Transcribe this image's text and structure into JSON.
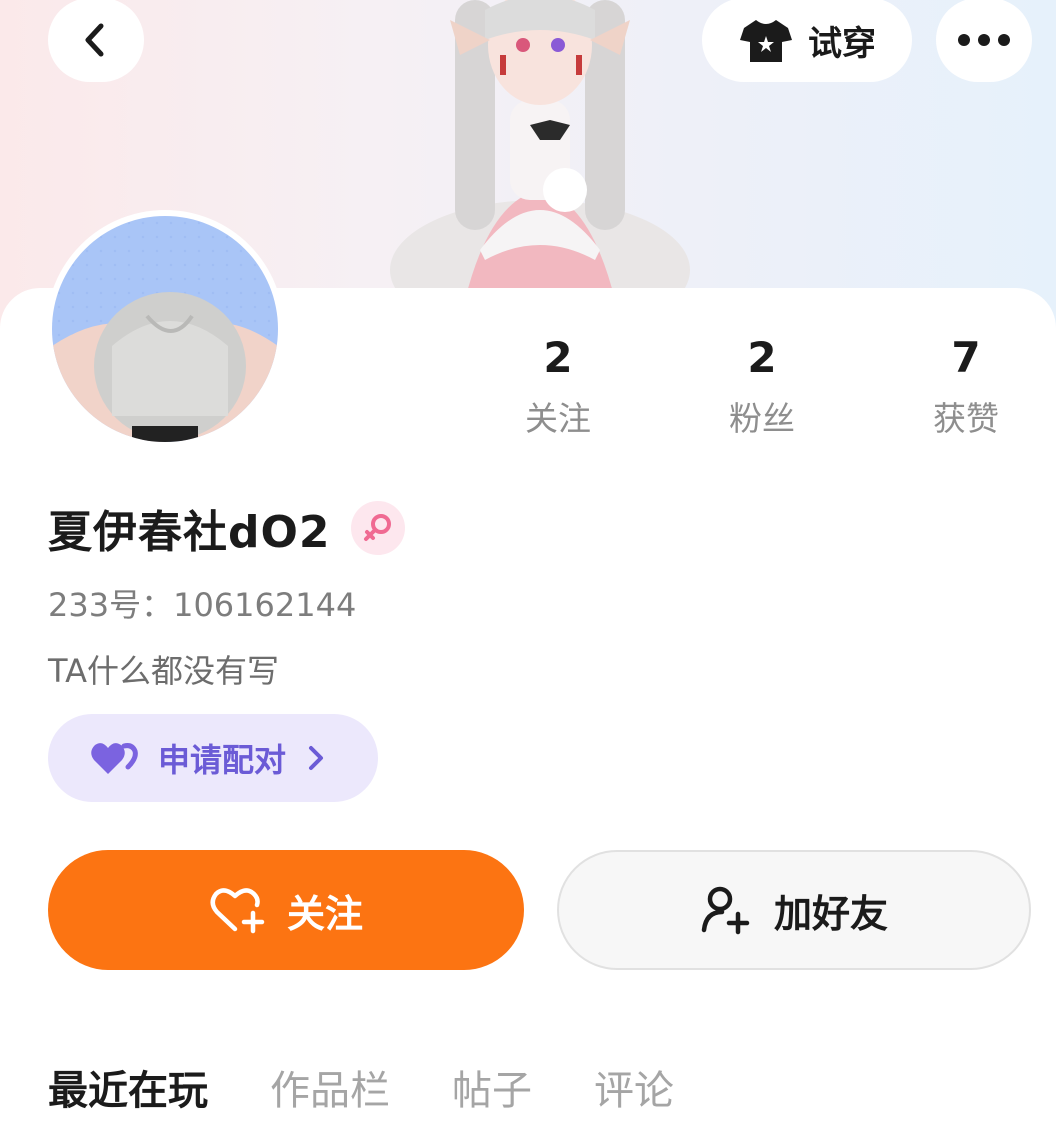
{
  "header": {
    "back_icon": "chevron-left-icon",
    "tryon_icon": "tshirt-icon",
    "tryon_label": "试穿",
    "more_icon": "more-dots-icon"
  },
  "profile": {
    "name": "夏伊春社dO2",
    "gender_icon": "female-icon",
    "uid_text": "233号：106162144",
    "bio": "TA什么都没有写"
  },
  "stats": [
    {
      "value": "2",
      "label": "关注"
    },
    {
      "value": "2",
      "label": "粉丝"
    },
    {
      "value": "7",
      "label": "获赞"
    }
  ],
  "pair": {
    "icon": "hearts-icon",
    "label": "申请配对"
  },
  "actions": {
    "follow_label": "关注",
    "add_friend_label": "加好友"
  },
  "tabs": [
    {
      "label": "最近在玩",
      "active": true
    },
    {
      "label": "作品栏",
      "active": false
    },
    {
      "label": "帖子",
      "active": false
    },
    {
      "label": "评论",
      "active": false
    }
  ],
  "colors": {
    "accent": "#fc7412",
    "pair_bg": "#ece8fc",
    "pair_text": "#6b5bd6",
    "female": "#f06a92"
  }
}
